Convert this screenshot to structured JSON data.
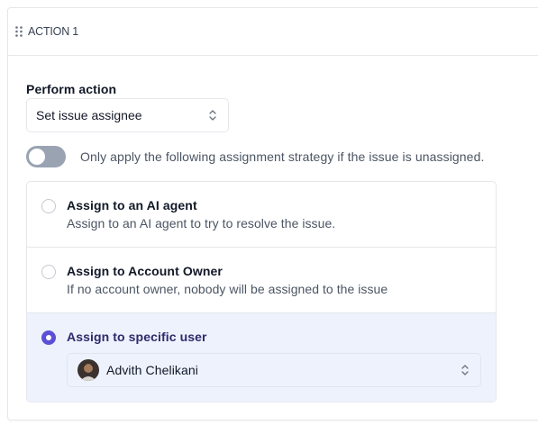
{
  "action": {
    "title": "ACTION 1",
    "perform_label": "Perform action",
    "perform_value": "Set issue assignee",
    "toggle_label": "Only apply the following assignment strategy if the issue is unassigned.",
    "toggle_on": false
  },
  "options": [
    {
      "title": "Assign to an AI agent",
      "description": "Assign to an AI agent to try to resolve the issue.",
      "selected": false
    },
    {
      "title": "Assign to Account Owner",
      "description": "If no account owner, nobody will be assigned to the issue",
      "selected": false
    },
    {
      "title": "Assign to specific user",
      "selected": true
    }
  ],
  "assignee": {
    "name": "Advith Chelikani"
  },
  "colors": {
    "accent": "#5b4fd6",
    "selected_bg": "#eef2fd",
    "toggle_off": "#9aa3b2",
    "border": "#e5e7eb"
  },
  "icons": [
    "drag-handle-icon",
    "chevron-up-down-icon",
    "avatar"
  ]
}
